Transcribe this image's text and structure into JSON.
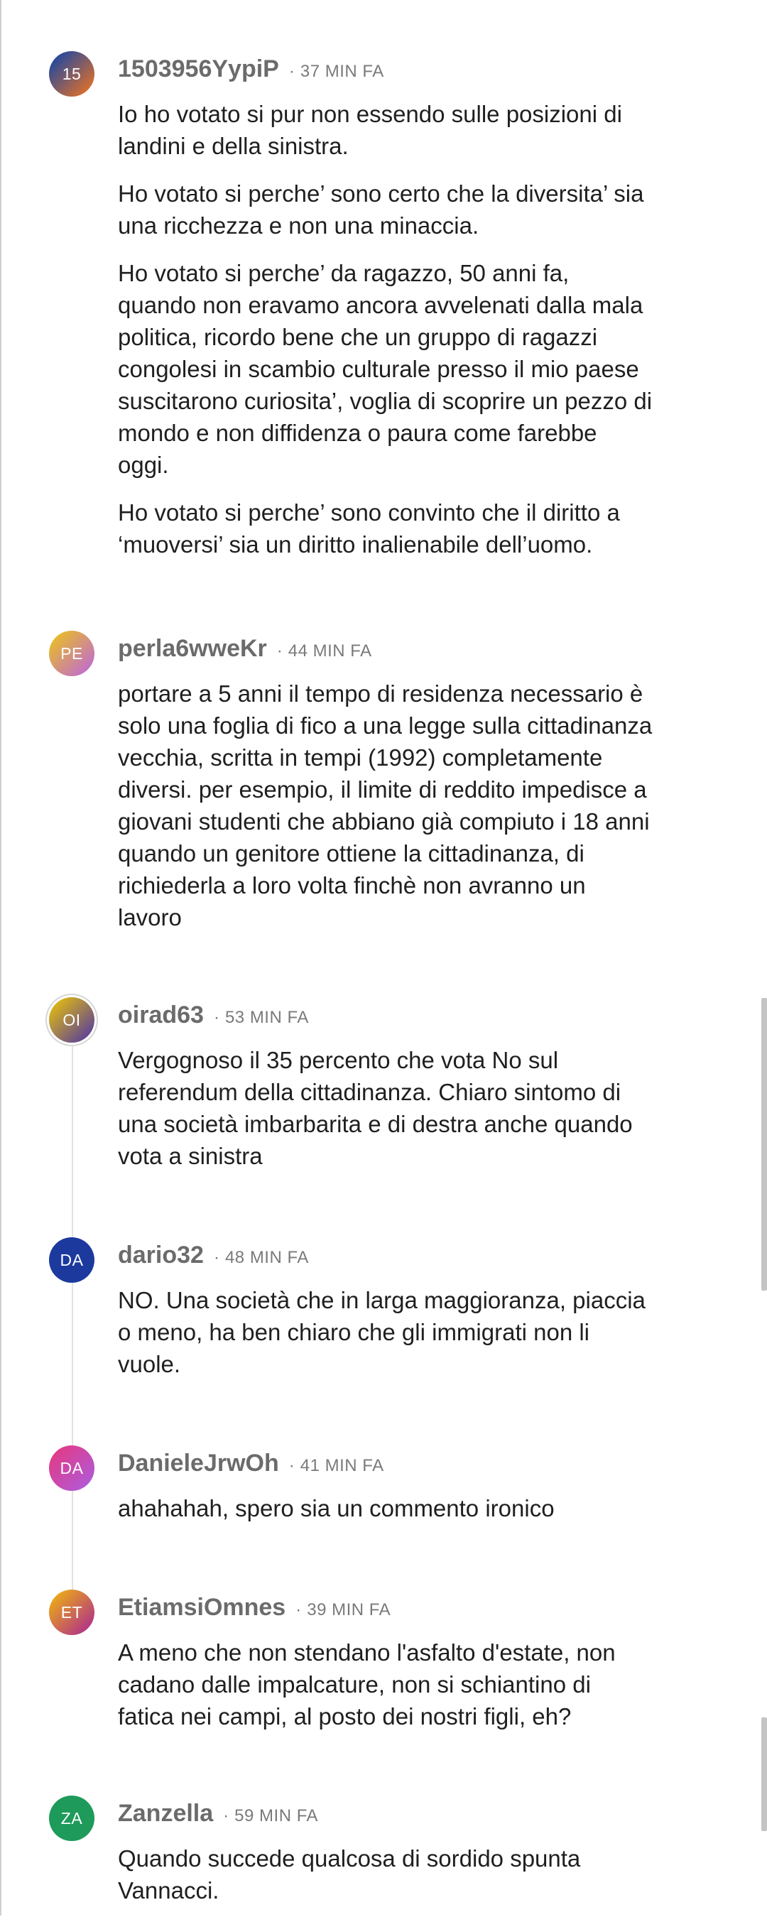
{
  "comments": [
    {
      "initials": "15",
      "username": "1503956YypiP",
      "time": "37 MIN FA",
      "avatar_gradient": [
        "#2a4a9a",
        "#e0702a"
      ],
      "paragraphs": [
        "Io ho votato si pur non essendo sulle posizioni di\nlandini e della sinistra.",
        "Ho votato si perche’ sono certo che la diversita’ sia\nuna ricchezza e non una minaccia.",
        "Ho votato si perche’ da ragazzo, 50 anni fa,\nquando non eravamo ancora avvelenati dalla mala\npolitica, ricordo bene che un gruppo di ragazzi\ncongolesi in scambio culturale presso il mio paese\nsuscitarono curiosita’, voglia di scoprire un pezzo di\nmondo e non diffidenza o paura come farebbe\noggi.",
        "Ho votato si perche’ sono convinto che il diritto a\n‘muoversi’ sia un diritto inalienabile dell’uomo."
      ]
    },
    {
      "initials": "PE",
      "username": "perla6wweKr",
      "time": "44 MIN FA",
      "avatar_gradient": [
        "#e6b830",
        "#c06cd0"
      ],
      "paragraphs": [
        "portare a 5 anni il tempo di residenza necessario è\nsolo una foglia di fico a una legge sulla cittadinanza\nvecchia, scritta in tempi (1992) completamente\ndiversi. per esempio, il limite di reddito impedisce a\ngiovani studenti che abbiano già compiuto i 18 anni\nquando un genitore ottiene la cittadinanza, di\nrichiederla a loro volta finchè non avranno un\nlavoro"
      ]
    },
    {
      "initials": "OI",
      "username": "oirad63",
      "time": "53 MIN FA",
      "avatar_gradient": [
        "#d8b21a",
        "#5a3f9a"
      ],
      "paragraphs": [
        "Vergognoso il 35 percento che vota No sul\nreferendum della cittadinanza. Chiaro sintomo di\nuna società imbarbarita e di destra anche quando\nvota a sinistra"
      ]
    },
    {
      "initials": "DA",
      "username": "dario32",
      "time": "48 MIN FA",
      "avatar_gradient": [
        "#1c3a9e",
        "#1c3a9e"
      ],
      "paragraphs": [
        "NO. Una società che in larga maggioranza, piaccia\no meno, ha ben chiaro che gli immigrati non li\nvuole."
      ]
    },
    {
      "initials": "DA",
      "username": "DanieleJrwOh",
      "time": "41 MIN FA",
      "avatar_gradient": [
        "#e03c8a",
        "#b05ad8"
      ],
      "paragraphs": [
        "ahahahah, spero sia un commento ironico"
      ]
    },
    {
      "initials": "ET",
      "username": "EtiamsiOmnes",
      "time": "39 MIN FA",
      "avatar_gradient": [
        "#e8a41c",
        "#b0308a"
      ],
      "paragraphs": [
        "A meno che non stendano l'asfalto d'estate, non\ncadano dalle impalcature, non si schiantino di\nfatica nei campi, al posto dei nostri figli, eh?"
      ]
    },
    {
      "initials": "ZA",
      "username": "Zanzella",
      "time": "59 MIN FA",
      "avatar_gradient": [
        "#1e9a5a",
        "#1e9a5a"
      ],
      "paragraphs": [
        "Quando succede qualcosa di sordido spunta\nVannacci."
      ]
    }
  ],
  "separator": "·"
}
